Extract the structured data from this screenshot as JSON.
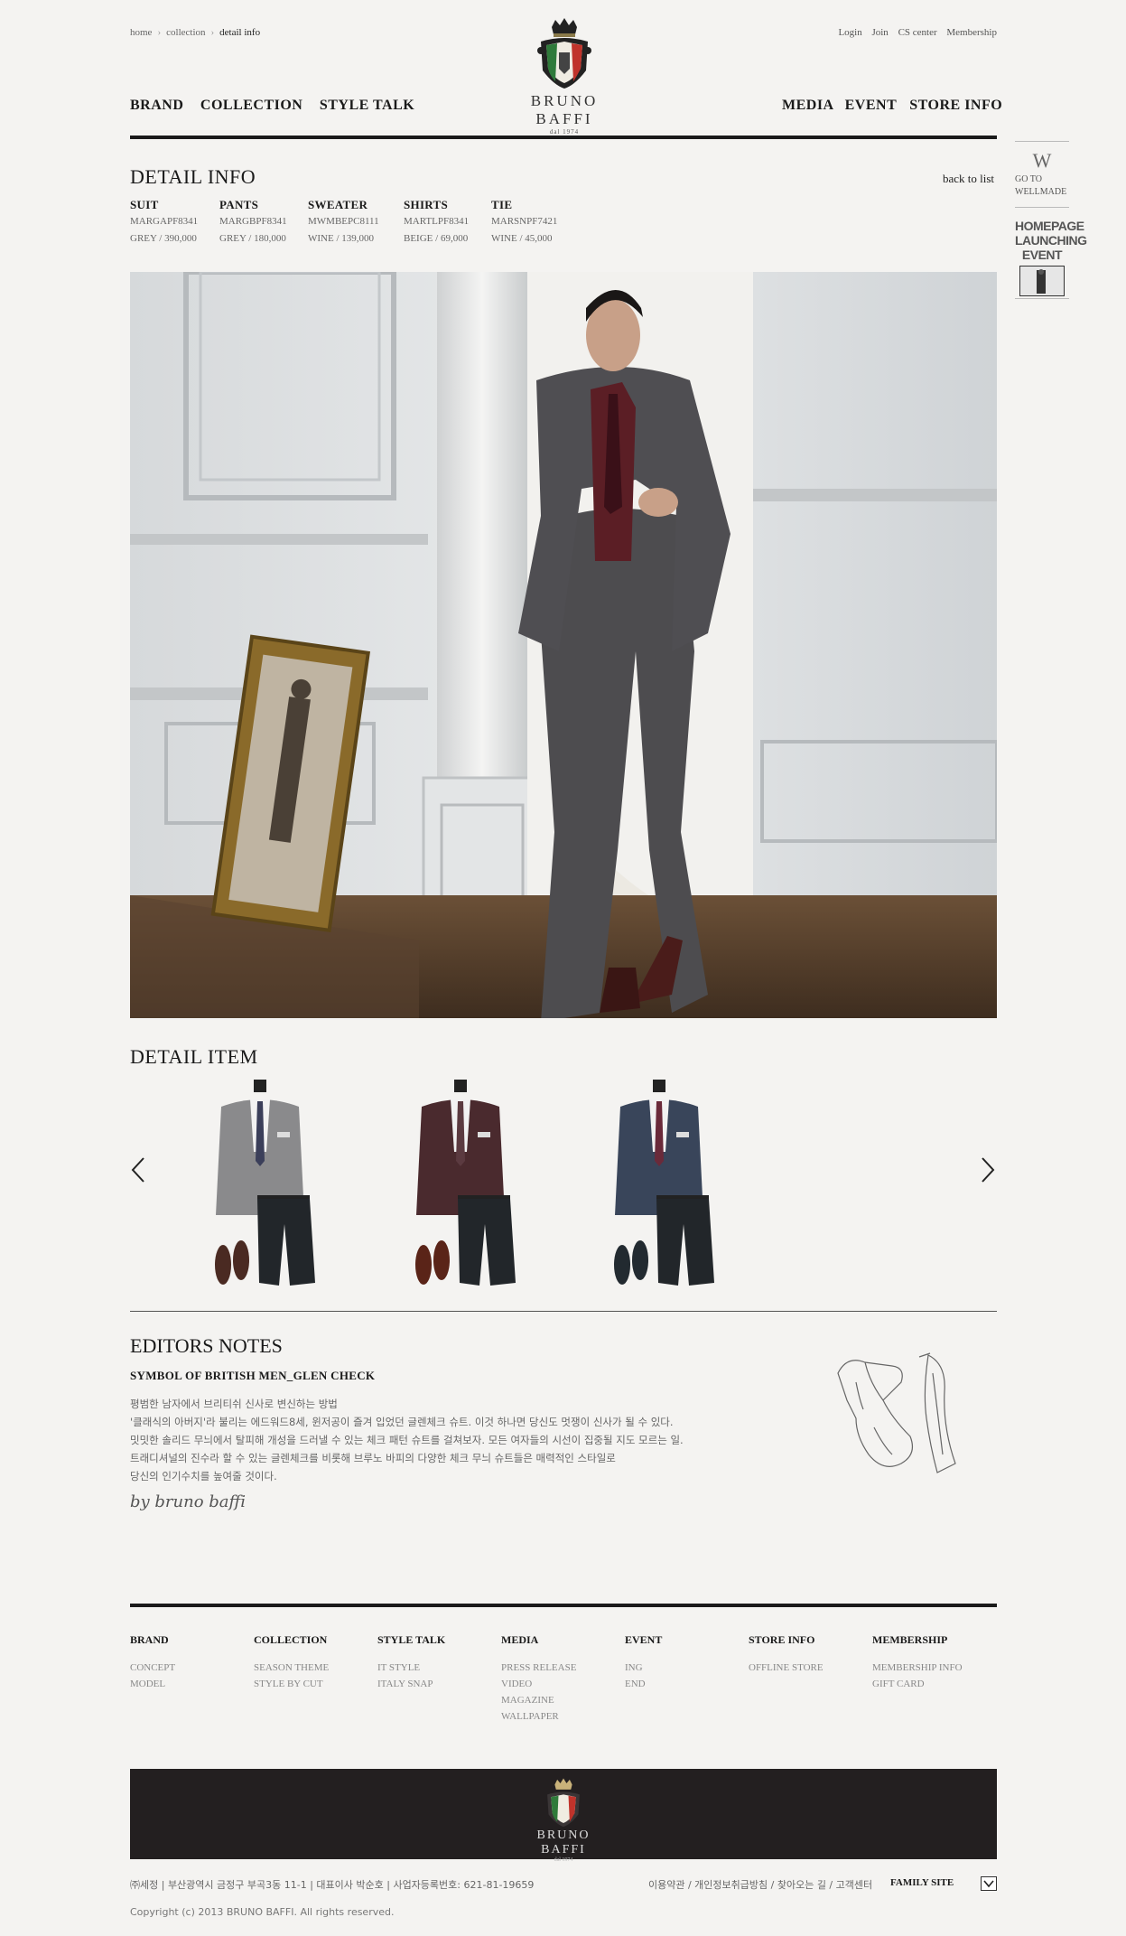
{
  "breadcrumb": {
    "items": [
      "home",
      "collection"
    ],
    "current": "detail info",
    "separator": "›"
  },
  "top_links": [
    "Login",
    "Join",
    "CS center",
    "Membership"
  ],
  "logo": {
    "name": "BRUNO BAFFI",
    "since": "dal 1974"
  },
  "nav": {
    "left": [
      "BRAND",
      "COLLECTION",
      "STYLE TALK"
    ],
    "right": [
      "MEDIA",
      "EVENT",
      "STORE INFO"
    ]
  },
  "detail_info": {
    "title": "DETAIL INFO",
    "back_label": "back to list",
    "specs": [
      {
        "name": "SUIT",
        "code": "MARGAPF8341",
        "price": "GREY / 390,000"
      },
      {
        "name": "PANTS",
        "code": "MARGBPF8341",
        "price": "GREY / 180,000"
      },
      {
        "name": "SWEATER",
        "code": "MWMBEPC8111",
        "price": "WINE / 139,000"
      },
      {
        "name": "SHIRTS",
        "code": "MARTLPF8341",
        "price": "BEIGE / 69,000"
      },
      {
        "name": "TIE",
        "code": "MARSNPF7421",
        "price": "WINE / 45,000"
      }
    ]
  },
  "side_panel": {
    "logo_letter": "W",
    "goto_lines": [
      "GO TO",
      "WELLMADE"
    ],
    "event_lines": [
      "HOMEPAGE",
      "LAUNCHING",
      "EVENT"
    ]
  },
  "detail_item": {
    "title": "DETAIL ITEM",
    "products": [
      {
        "suit_color": "#8a8a8c",
        "tie_color": "#3b3f5a",
        "shoe_color": "#4a2a22"
      },
      {
        "suit_color": "#4a2a2e",
        "tie_color": "#5b3a40",
        "shoe_color": "#5a2418"
      },
      {
        "suit_color": "#39455a",
        "tie_color": "#6a2a3a",
        "shoe_color": "#222a30"
      }
    ]
  },
  "editors_notes": {
    "title": "EDITORS NOTES",
    "subtitle": "SYMBOL OF BRITISH MEN_GLEN CHECK",
    "body": [
      "평범한 남자에서 브리티쉬 신사로 변신하는 방법",
      "'클래식의 아버지'라 불리는 에드워드8세, 윈저공이 즐겨 입었던 글렌체크 슈트. 이것 하나면 당신도 멋쟁이 신사가 될 수 있다.",
      "밋밋한 솔리드 무늬에서 탈피해 개성을 드러낼 수 있는 체크 패턴 슈트를 걸쳐보자. 모든 여자들의 시선이 집중될 지도 모르는 일.",
      "트래디셔널의 진수라 할 수 있는 글렌체크를 비롯해 브루노 바피의 다양한 체크 무늬 슈트들은 매력적인 스타일로",
      "당신의 인기수치를 높여줄 것이다."
    ],
    "signature": "by bruno baffi"
  },
  "footer": {
    "columns": [
      {
        "heading": "BRAND",
        "items": [
          "CONCEPT",
          "MODEL"
        ]
      },
      {
        "heading": "COLLECTION",
        "items": [
          "SEASON THEME",
          "STYLE BY CUT"
        ]
      },
      {
        "heading": "STYLE TALK",
        "items": [
          "IT STYLE",
          "ITALY SNAP"
        ]
      },
      {
        "heading": "MEDIA",
        "items": [
          "PRESS RELEASE",
          "VIDEO",
          "MAGAZINE",
          "WALLPAPER"
        ]
      },
      {
        "heading": "EVENT",
        "items": [
          "ING",
          "END"
        ]
      },
      {
        "heading": "STORE INFO",
        "items": [
          "OFFLINE STORE"
        ]
      },
      {
        "heading": "MEMBERSHIP",
        "items": [
          "MEMBERSHIP INFO",
          "GIFT CARD"
        ]
      }
    ],
    "address": "㈜세정 | 부산광역시 금정구 부곡3동 11-1 | 대표이사 박순호 | 사업자등록번호: 621-81-19659",
    "policy": "이용약관 / 개인정보취급방침 / 찾아오는 길 / 고객센터",
    "family_site": "FAMILY SITE",
    "copyright": "Copyright (c) 2013 BRUNO BAFFI. All rights reserved."
  }
}
